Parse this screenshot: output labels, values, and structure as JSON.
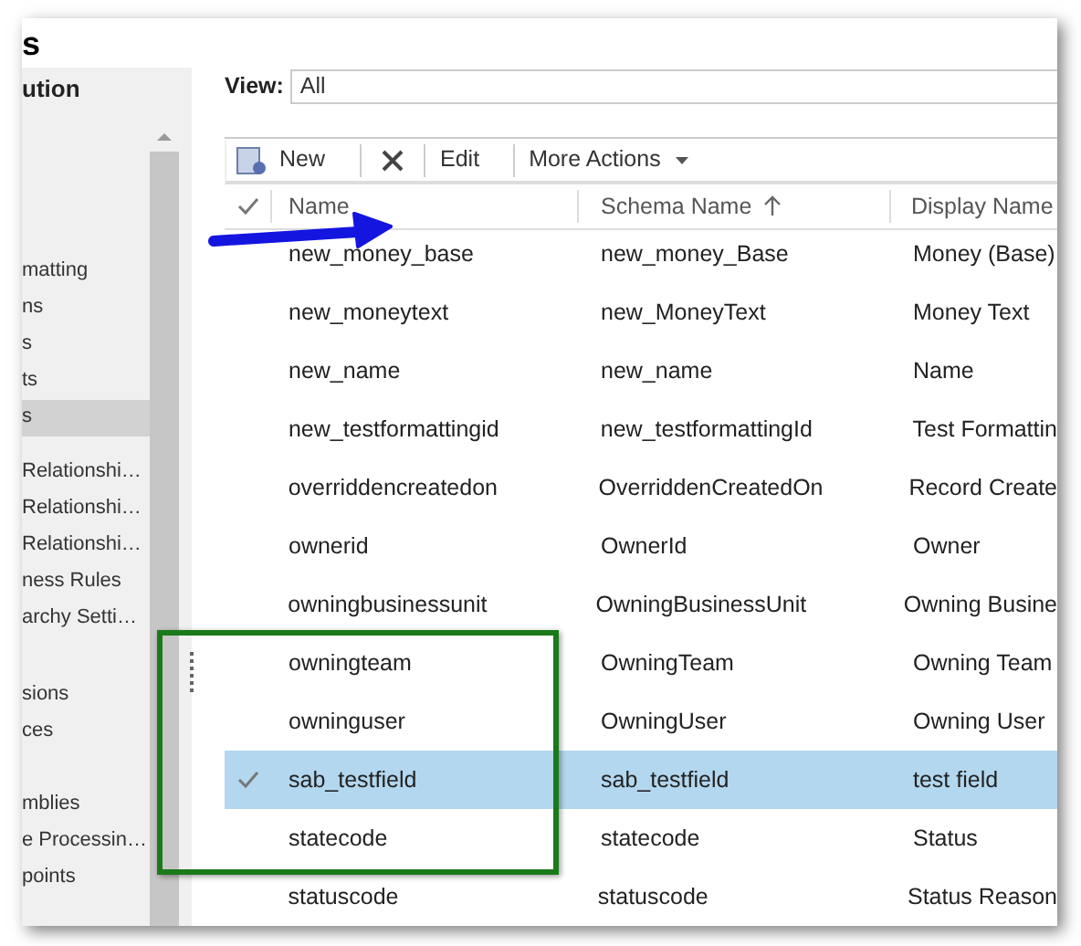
{
  "window": {
    "title": "s"
  },
  "sidebar": {
    "heading": "ution",
    "items": [
      {
        "label": "matting",
        "selected": false
      },
      {
        "label": "ns",
        "selected": false
      },
      {
        "label": "s",
        "selected": false
      },
      {
        "label": "ts",
        "selected": false
      },
      {
        "label": "s",
        "selected": true
      },
      {
        "label": "Relationshi…",
        "selected": false
      },
      {
        "label": "Relationshi…",
        "selected": false
      },
      {
        "label": "Relationshi…",
        "selected": false
      },
      {
        "label": "ness Rules",
        "selected": false
      },
      {
        "label": "archy Setti…",
        "selected": false
      },
      {
        "label": "sions",
        "selected": false
      },
      {
        "label": "ces",
        "selected": false
      },
      {
        "label": "mblies",
        "selected": false
      },
      {
        "label": "e Processin…",
        "selected": false
      },
      {
        "label": "points",
        "selected": false
      }
    ]
  },
  "view": {
    "label": "View:",
    "value": "All"
  },
  "toolbar": {
    "new": "New",
    "edit": "Edit",
    "more": "More Actions"
  },
  "table": {
    "columns": [
      {
        "label": "Name",
        "sorted": false
      },
      {
        "label": "Schema Name",
        "sorted": true
      },
      {
        "label": "Display Name",
        "sorted": false
      }
    ],
    "rows": [
      {
        "name": "new_money_base",
        "schema": "new_money_Base",
        "display": "Money (Base)",
        "selected": false
      },
      {
        "name": "new_moneytext",
        "schema": "new_MoneyText",
        "display": "Money Text",
        "selected": false
      },
      {
        "name": "new_name",
        "schema": "new_name",
        "display": "Name",
        "selected": false
      },
      {
        "name": "new_testformattingid",
        "schema": "new_testformattingId",
        "display": "Test Formattin",
        "selected": false
      },
      {
        "name": "overriddencreatedon",
        "schema": "OverriddenCreatedOn",
        "display": "Record Create",
        "selected": false
      },
      {
        "name": "ownerid",
        "schema": "OwnerId",
        "display": "Owner",
        "selected": false
      },
      {
        "name": "owningbusinessunit",
        "schema": "OwningBusinessUnit",
        "display": "Owning Busine",
        "selected": false
      },
      {
        "name": "owningteam",
        "schema": "OwningTeam",
        "display": "Owning Team",
        "selected": false
      },
      {
        "name": "owninguser",
        "schema": "OwningUser",
        "display": "Owning User",
        "selected": false
      },
      {
        "name": "sab_testfield",
        "schema": "sab_testfield",
        "display": "test field",
        "selected": true
      },
      {
        "name": "statecode",
        "schema": "statecode",
        "display": "Status",
        "selected": false
      },
      {
        "name": "statuscode",
        "schema": "statuscode",
        "display": "Status Reason",
        "selected": false
      }
    ]
  }
}
